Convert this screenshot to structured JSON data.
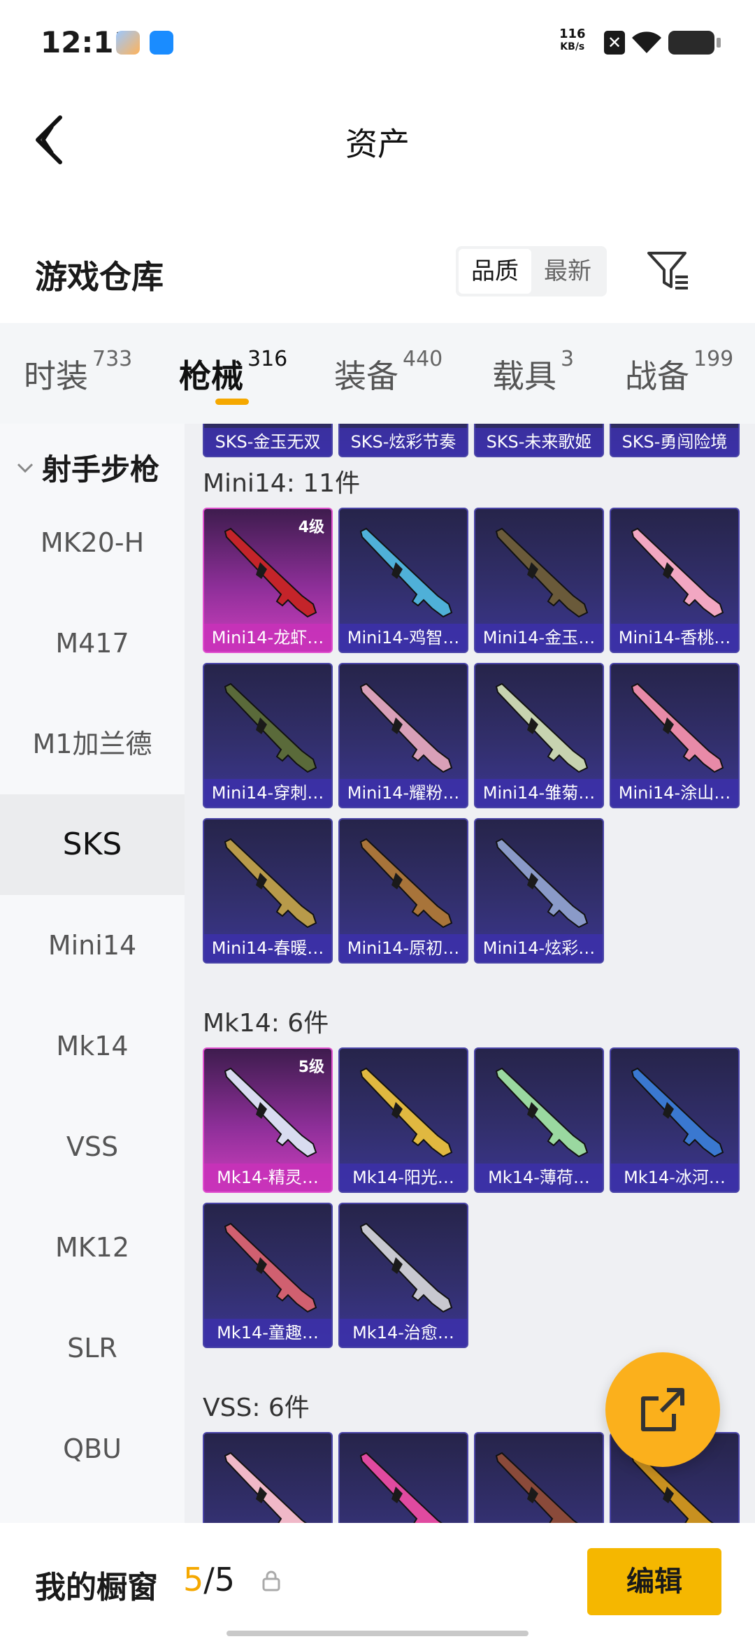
{
  "status_bar": {
    "time": "12:11",
    "net_speed_value": "116",
    "net_speed_unit": "KB/s"
  },
  "header": {
    "title": "资产"
  },
  "warehouse": {
    "title": "游戏仓库",
    "sort_options": [
      "品质",
      "最新"
    ],
    "active_sort": "品质"
  },
  "tabs": [
    {
      "label": "时装",
      "count": "733"
    },
    {
      "label": "枪械",
      "count": "316"
    },
    {
      "label": "装备",
      "count": "440"
    },
    {
      "label": "载具",
      "count": "3"
    },
    {
      "label": "战备",
      "count": "199"
    }
  ],
  "sidebar": {
    "group": "射手步枪",
    "items": [
      "MK20-H",
      "M417",
      "M1加兰德",
      "SKS",
      "Mini14",
      "Mk14",
      "VSS",
      "MK12",
      "SLR",
      "QBU"
    ],
    "active": "SKS"
  },
  "content": {
    "top_row": [
      "SKS-金玉无双",
      "SKS-炫彩节奏",
      "SKS-未来歌姬",
      "SKS-勇闯险境"
    ],
    "groups": [
      {
        "label": "Mini14: 11件",
        "items": [
          {
            "name": "Mini14-龙虾…",
            "level": "4级",
            "rarity": "pink",
            "gun_color": "#c4242a"
          },
          {
            "name": "Mini14-鸡智…",
            "level": "",
            "rarity": "purple",
            "gun_color": "#4fb0d8"
          },
          {
            "name": "Mini14-金玉…",
            "level": "",
            "rarity": "purple",
            "gun_color": "#6a5a3a"
          },
          {
            "name": "Mini14-香桃…",
            "level": "",
            "rarity": "purple",
            "gun_color": "#f2a7c2"
          },
          {
            "name": "Mini14-穿刺…",
            "level": "",
            "rarity": "purple",
            "gun_color": "#5a6a3a"
          },
          {
            "name": "Mini14-耀粉…",
            "level": "",
            "rarity": "purple",
            "gun_color": "#d9a0b8"
          },
          {
            "name": "Mini14-雏菊…",
            "level": "",
            "rarity": "purple",
            "gun_color": "#c7d3b0"
          },
          {
            "name": "Mini14-涂山…",
            "level": "",
            "rarity": "purple",
            "gun_color": "#e88aa8"
          },
          {
            "name": "Mini14-春暖…",
            "level": "",
            "rarity": "purple",
            "gun_color": "#b89a4a"
          },
          {
            "name": "Mini14-原初…",
            "level": "",
            "rarity": "purple",
            "gun_color": "#a8743a"
          },
          {
            "name": "Mini14-炫彩…",
            "level": "",
            "rarity": "purple",
            "gun_color": "#8a9ac8"
          }
        ]
      },
      {
        "label": "Mk14: 6件",
        "items": [
          {
            "name": "Mk14-精灵…",
            "level": "5级",
            "rarity": "pink",
            "gun_color": "#d8dcf0"
          },
          {
            "name": "Mk14-阳光…",
            "level": "",
            "rarity": "purple",
            "gun_color": "#e0b840"
          },
          {
            "name": "Mk14-薄荷…",
            "level": "",
            "rarity": "purple",
            "gun_color": "#9ad8a0"
          },
          {
            "name": "Mk14-冰河…",
            "level": "",
            "rarity": "purple",
            "gun_color": "#3a78d0"
          },
          {
            "name": "Mk14-童趣…",
            "level": "",
            "rarity": "purple",
            "gun_color": "#d06070"
          },
          {
            "name": "Mk14-治愈…",
            "level": "",
            "rarity": "purple",
            "gun_color": "#c8c8d0"
          }
        ]
      },
      {
        "label": "VSS: 6件",
        "items": [
          {
            "name": "",
            "level": "",
            "rarity": "purple",
            "gun_color": "#f0b8c8"
          },
          {
            "name": "",
            "level": "",
            "rarity": "purple",
            "gun_color": "#e04aa0"
          },
          {
            "name": "",
            "level": "",
            "rarity": "purple",
            "gun_color": "#8a4a3a"
          },
          {
            "name": "",
            "level": "",
            "rarity": "purple",
            "gun_color": "#c89020"
          }
        ]
      }
    ]
  },
  "bottom_bar": {
    "title": "我的橱窗",
    "current": "5",
    "sep_total": "/5",
    "edit_label": "编辑"
  },
  "colors": {
    "accent": "#f5b700",
    "pink_rarity": "#cf3fbe",
    "purple_rarity": "#3b3690"
  }
}
